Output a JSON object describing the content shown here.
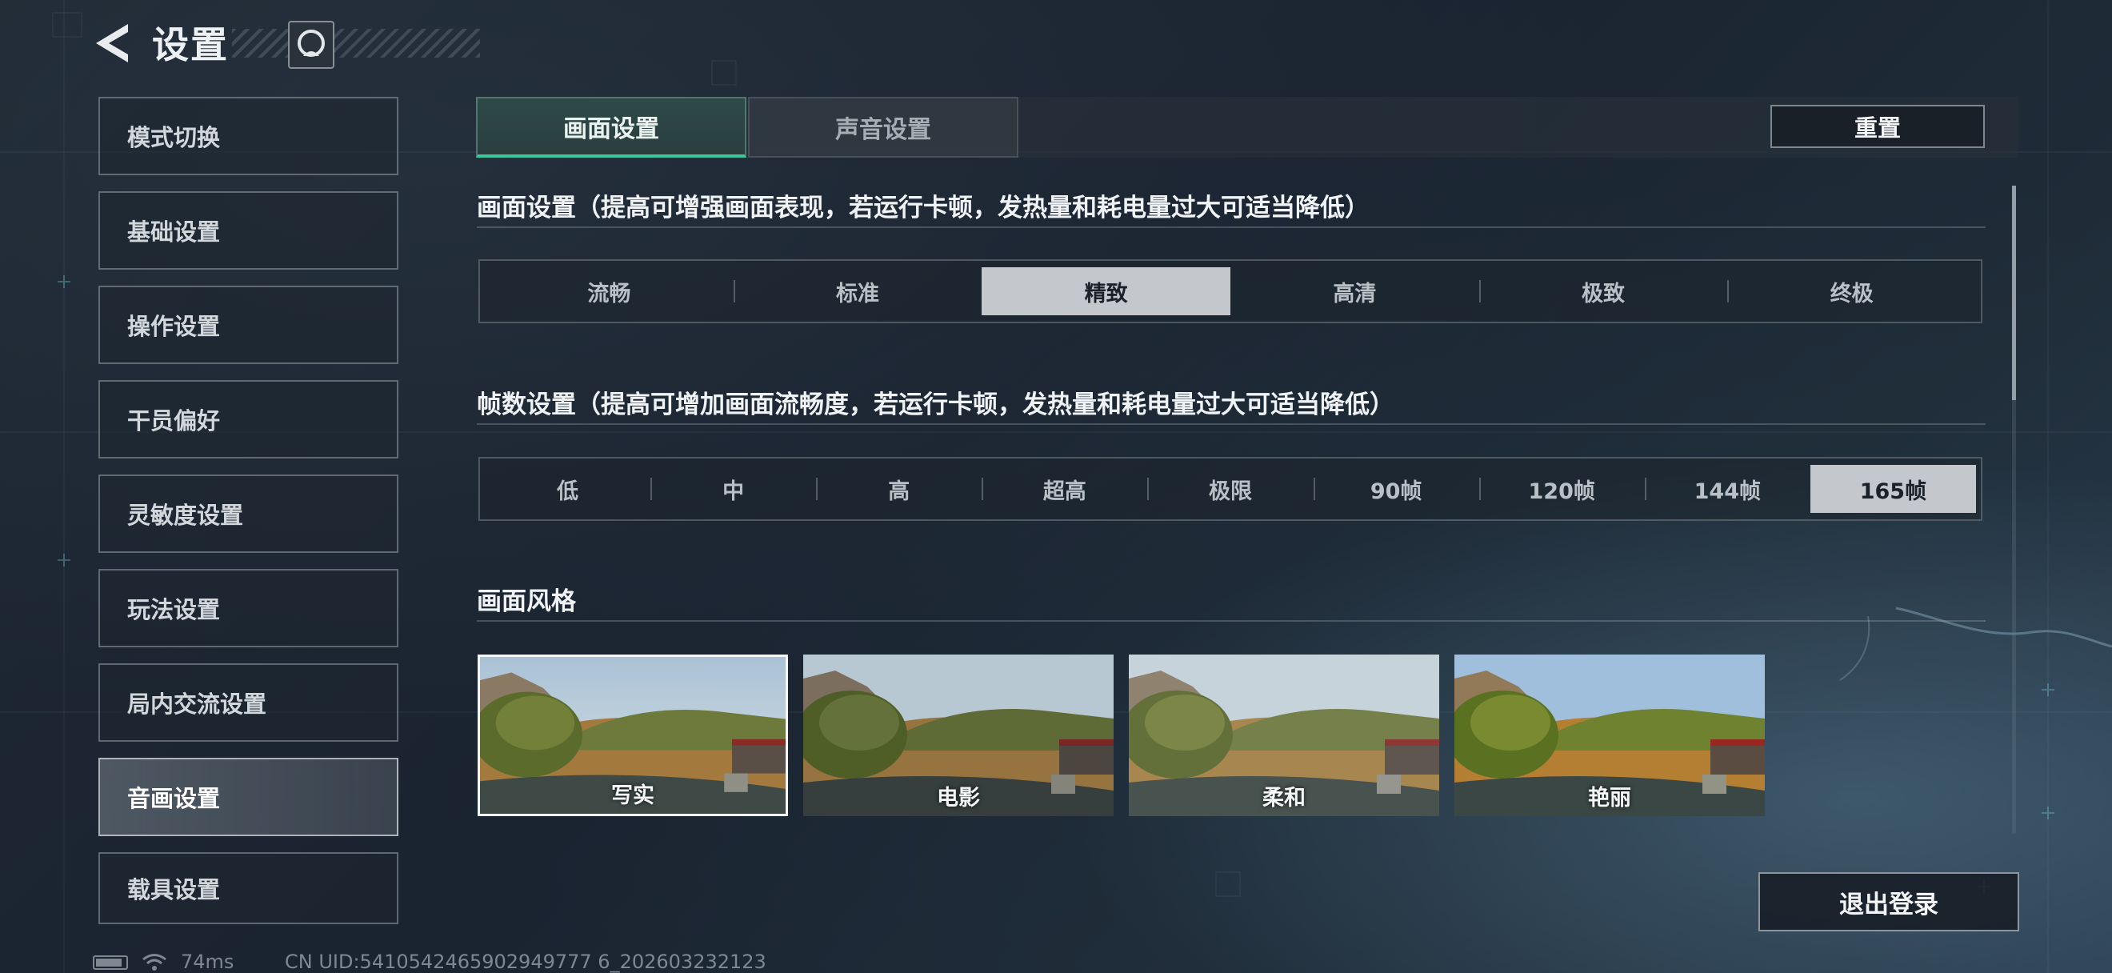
{
  "header": {
    "title": "设置"
  },
  "sidebar": {
    "items": [
      {
        "label": "模式切换",
        "active": false
      },
      {
        "label": "基础设置",
        "active": false
      },
      {
        "label": "操作设置",
        "active": false
      },
      {
        "label": "干员偏好",
        "active": false
      },
      {
        "label": "灵敏度设置",
        "active": false
      },
      {
        "label": "玩法设置",
        "active": false
      },
      {
        "label": "局内交流设置",
        "active": false
      },
      {
        "label": "音画设置",
        "active": true
      },
      {
        "label": "载具设置",
        "active": false
      }
    ]
  },
  "tabs": [
    {
      "label": "画面设置",
      "active": true
    },
    {
      "label": "声音设置",
      "active": false
    }
  ],
  "toolbar": {
    "reset_label": "重置"
  },
  "graphics": {
    "title": "画面设置（提高可增强画面表现，若运行卡顿，发热量和耗电量过大可适当降低）",
    "options": [
      "流畅",
      "标准",
      "精致",
      "高清",
      "极致",
      "终极"
    ],
    "selected": "精致"
  },
  "framerate": {
    "title": "帧数设置（提高可增加画面流畅度，若运行卡顿，发热量和耗电量过大可适当降低）",
    "options": [
      "低",
      "中",
      "高",
      "超高",
      "极限",
      "90帧",
      "120帧",
      "144帧",
      "165帧"
    ],
    "selected": "165帧"
  },
  "style": {
    "title": "画面风格",
    "options": [
      {
        "label": "写实",
        "selected": true
      },
      {
        "label": "电影",
        "selected": false
      },
      {
        "label": "柔和",
        "selected": false
      },
      {
        "label": "艳丽",
        "selected": false
      }
    ]
  },
  "footer": {
    "logout_label": "退出登录",
    "ping": "74ms",
    "uid": "CN UID:5410542465902949777 6_202603232123"
  },
  "colors": {
    "accent": "#3fc59a",
    "selected_bg": "#c4c8cc"
  }
}
